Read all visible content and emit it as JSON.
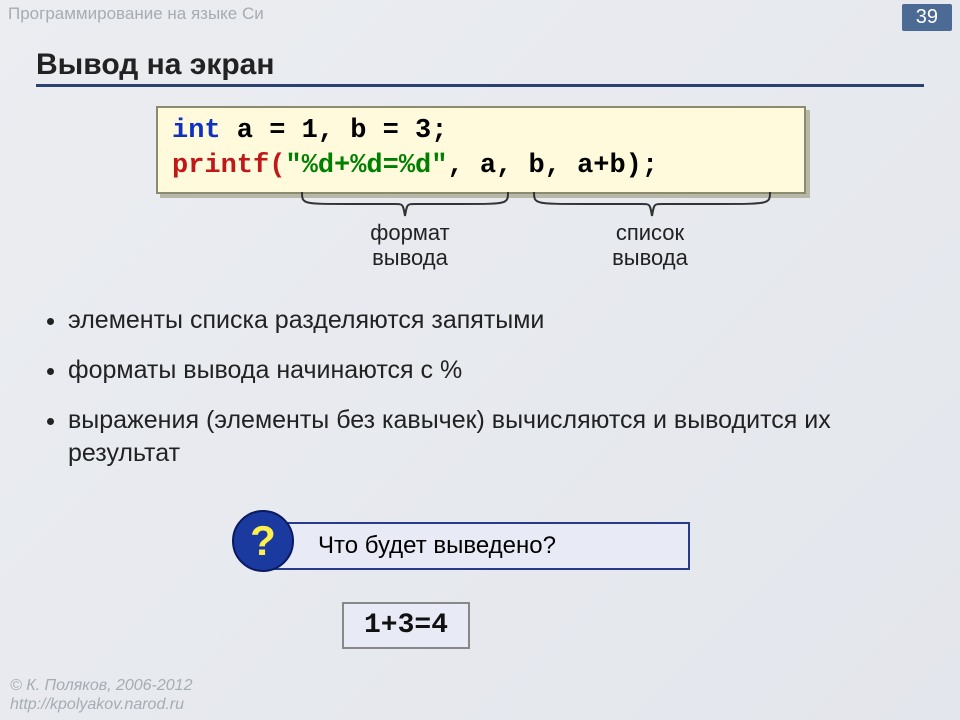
{
  "header": {
    "course": "Программирование на языке Си",
    "page": "39"
  },
  "title": "Вывод на экран",
  "code": {
    "line1_kw": "int",
    "line1_rest": " a = 1, b = 3;",
    "line2_func": "printf(",
    "line2_fmt": "\"%d+%d=%d\"",
    "line2_args": ", a, b, a+b);"
  },
  "labels": {
    "format_l1": "формат",
    "format_l2": "вывода",
    "list_l1": "список",
    "list_l2": "вывода"
  },
  "bullets": [
    "элементы списка разделяются запятыми",
    "форматы вывода начинаются с %",
    "выражения (элементы без кавычек) вычисляются и выводится их результат"
  ],
  "question": {
    "mark": "?",
    "text": "Что будет выведено?"
  },
  "answer": "1+3=4",
  "footer": {
    "author": "© К. Поляков, 2006-2012",
    "url": "http://kpolyakov.narod.ru"
  }
}
